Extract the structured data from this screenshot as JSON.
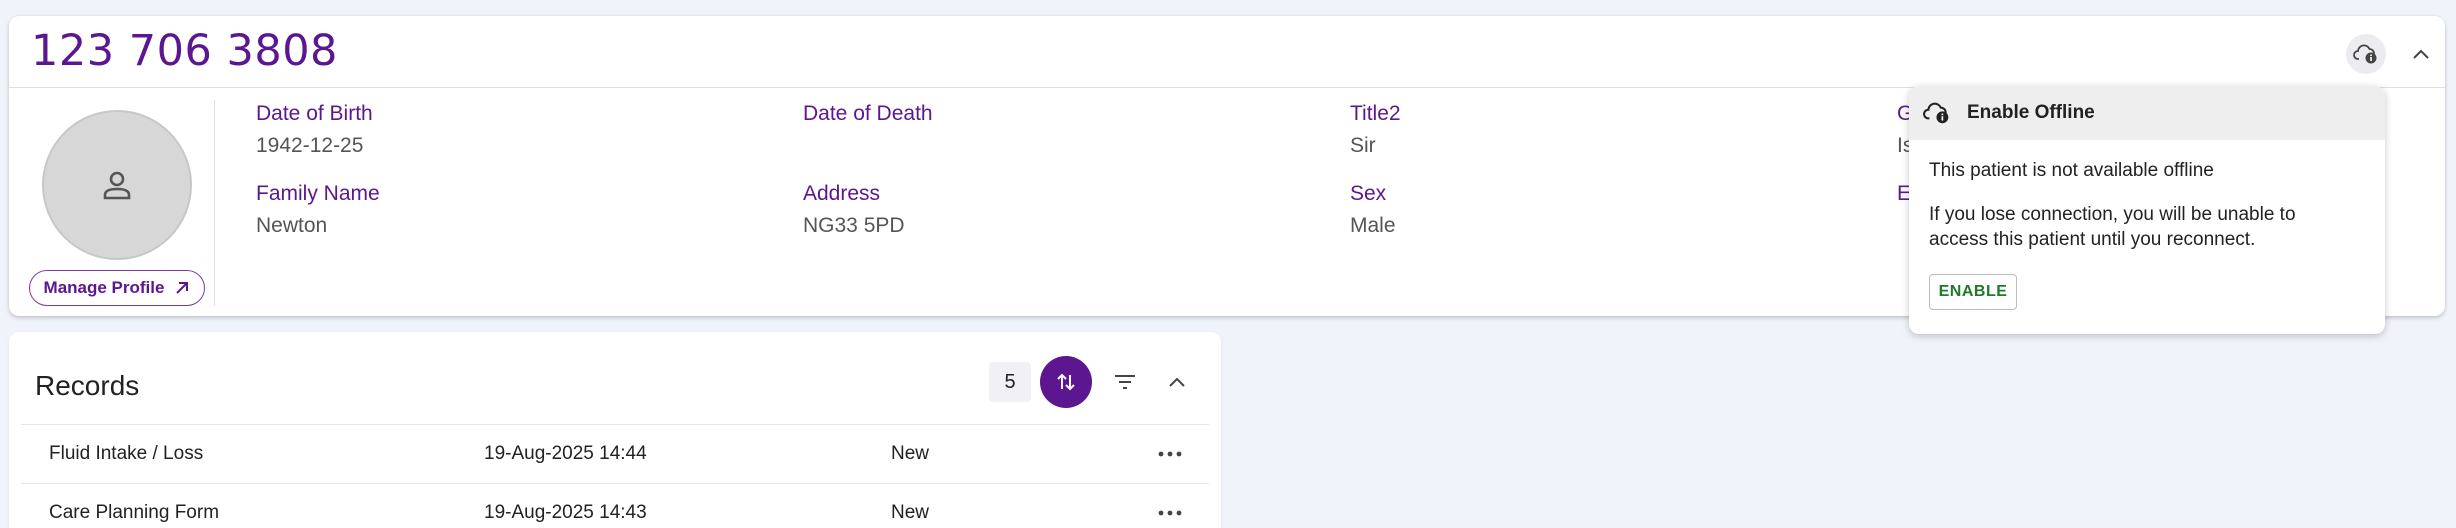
{
  "patient": {
    "nhs_number": "123 706 3808",
    "manage_profile_label": "Manage Profile",
    "fields": {
      "dob_label": "Date of Birth",
      "dob_value": "1942-12-25",
      "dod_label": "Date of Death",
      "dod_value": "",
      "title2_label": "Title2",
      "title2_value": "Sir",
      "col4_row1_label": "G",
      "col4_row1_value": "Is",
      "family_label": "Family Name",
      "family_value": "Newton",
      "address_label": "Address",
      "address_value": "NG33 5PD",
      "sex_label": "Sex",
      "sex_value": "Male",
      "col4_row2_label": "E"
    }
  },
  "offline_popup": {
    "title": "Enable Offline",
    "status_text": "This patient is not available offline",
    "description": "If you lose connection, you will be unable to access this patient until you reconnect.",
    "enable_label": "ENABLE"
  },
  "records": {
    "title": "Records",
    "count": "5",
    "rows": [
      {
        "name": "Fluid Intake / Loss",
        "date": "19-Aug-2025 14:44",
        "status": "New"
      },
      {
        "name": "Care Planning Form",
        "date": "19-Aug-2025 14:43",
        "status": "New"
      }
    ]
  },
  "colors": {
    "accent": "#5b1690",
    "enable_green": "#1f7a2c",
    "background": "#f1f3fb"
  },
  "icons": [
    "cloud-info-icon",
    "chevron-up-icon",
    "person-icon",
    "arrow-up-right-icon",
    "sort-icon",
    "filter-icon",
    "more-horizontal-icon"
  ]
}
